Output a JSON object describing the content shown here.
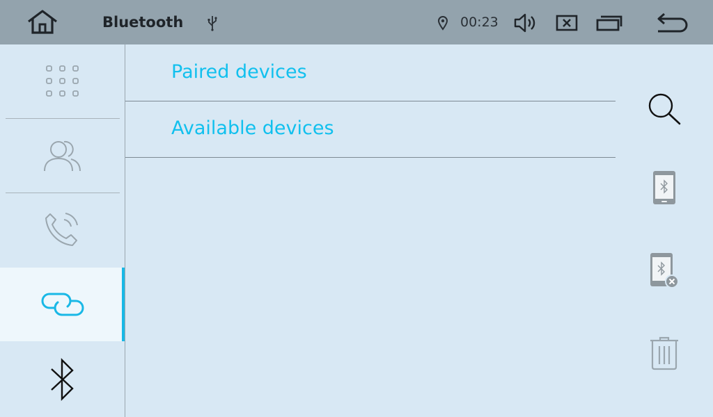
{
  "header": {
    "title": "Bluetooth",
    "time": "00:23",
    "icons": [
      "home-icon",
      "usb-icon",
      "location-icon",
      "volume-icon",
      "close-box-icon",
      "window-icon",
      "back-icon"
    ]
  },
  "sidebar": {
    "items": [
      {
        "name": "apps",
        "icon": "grid-icon",
        "active": false
      },
      {
        "name": "contacts",
        "icon": "contacts-icon",
        "active": false
      },
      {
        "name": "calls",
        "icon": "phone-icon",
        "active": false
      },
      {
        "name": "link",
        "icon": "link-icon",
        "active": true
      },
      {
        "name": "bluetooth",
        "icon": "bluetooth-icon",
        "active": false
      }
    ]
  },
  "main": {
    "rows": [
      {
        "label": "Paired devices"
      },
      {
        "label": "Available devices"
      }
    ]
  },
  "actions": [
    "search-icon",
    "phone-bluetooth-icon",
    "phone-bluetooth-remove-icon",
    "trash-icon"
  ],
  "colors": {
    "header_bg": "#93a3ad",
    "background": "#d8e8f4",
    "accent": "#19b8e6",
    "link_text": "#11c0ee"
  }
}
